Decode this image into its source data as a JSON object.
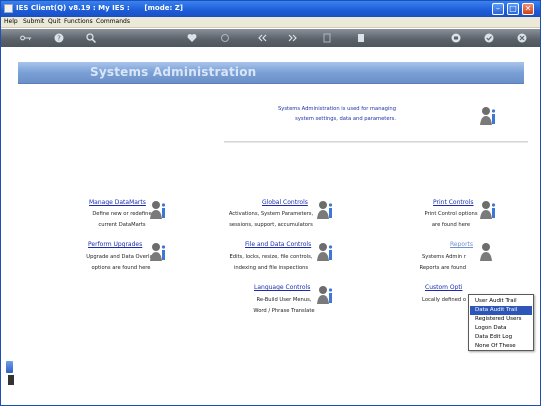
{
  "window": {
    "title": "IES Client(Q) v8.19 : My IES :      [mode: Z]",
    "buttons": {
      "minimize": "–",
      "maximize": "□",
      "close": "✕"
    }
  },
  "menubar": {
    "items": [
      "Help",
      "Submit",
      "Quit",
      "Functions",
      "Commands"
    ]
  },
  "toolbar": {
    "icons": [
      "key-icon",
      "help-icon",
      "search-icon",
      "heart-icon",
      "clip-icon",
      "back-icon",
      "forward-icon",
      "exit-icon",
      "grid-icon",
      "print-icon",
      "check-icon",
      "close-icon"
    ]
  },
  "page": {
    "banner_title": "Systems Administration",
    "intro_line1": "Systems Administration is used for managing",
    "intro_line2": "system settings, data and parameters."
  },
  "sections": {
    "manage_datamarts": {
      "title": "Manage DataMarts",
      "line1": "Define new or redefine",
      "line2": "current DataMarts"
    },
    "perform_upgrades": {
      "title": "Perform Upgrades",
      "line1": "Upgrade and Data Overlay",
      "line2": "options are found here"
    },
    "global_controls": {
      "title": "Global Controls",
      "line1": "Activations, System Parameters,",
      "line2": "sessions, support, accumulators"
    },
    "file_data_controls": {
      "title": "File and Data Controls",
      "line1": "Edits, locks, resize, file controls,",
      "line2": "indexing and file inspections"
    },
    "language_controls": {
      "title": "Language Controls",
      "line1": "Re-Build User Menus,",
      "line2": "Word / Phrase Translate"
    },
    "print_controls": {
      "title": "Print Controls",
      "line1": "Print Control options",
      "line2": "are found here"
    },
    "reports": {
      "title": "Reports",
      "line1": "Systems Admin r",
      "line2": "Reports are found"
    },
    "custom_options": {
      "title": "Custom Opti",
      "line1": "Locally defined o"
    }
  },
  "context_menu": {
    "items": [
      "User Audit Trail",
      "Data Audit Trail",
      "Registered Users",
      "Logon Data",
      "Data Edit Log",
      "None Of These"
    ],
    "selected": "Data Audit Trail"
  },
  "colors": {
    "title_bar": "#1d5bd6",
    "banner": "#7aa0d6",
    "link": "#1a2bb0",
    "menu_highlight": "#2d56b8"
  }
}
